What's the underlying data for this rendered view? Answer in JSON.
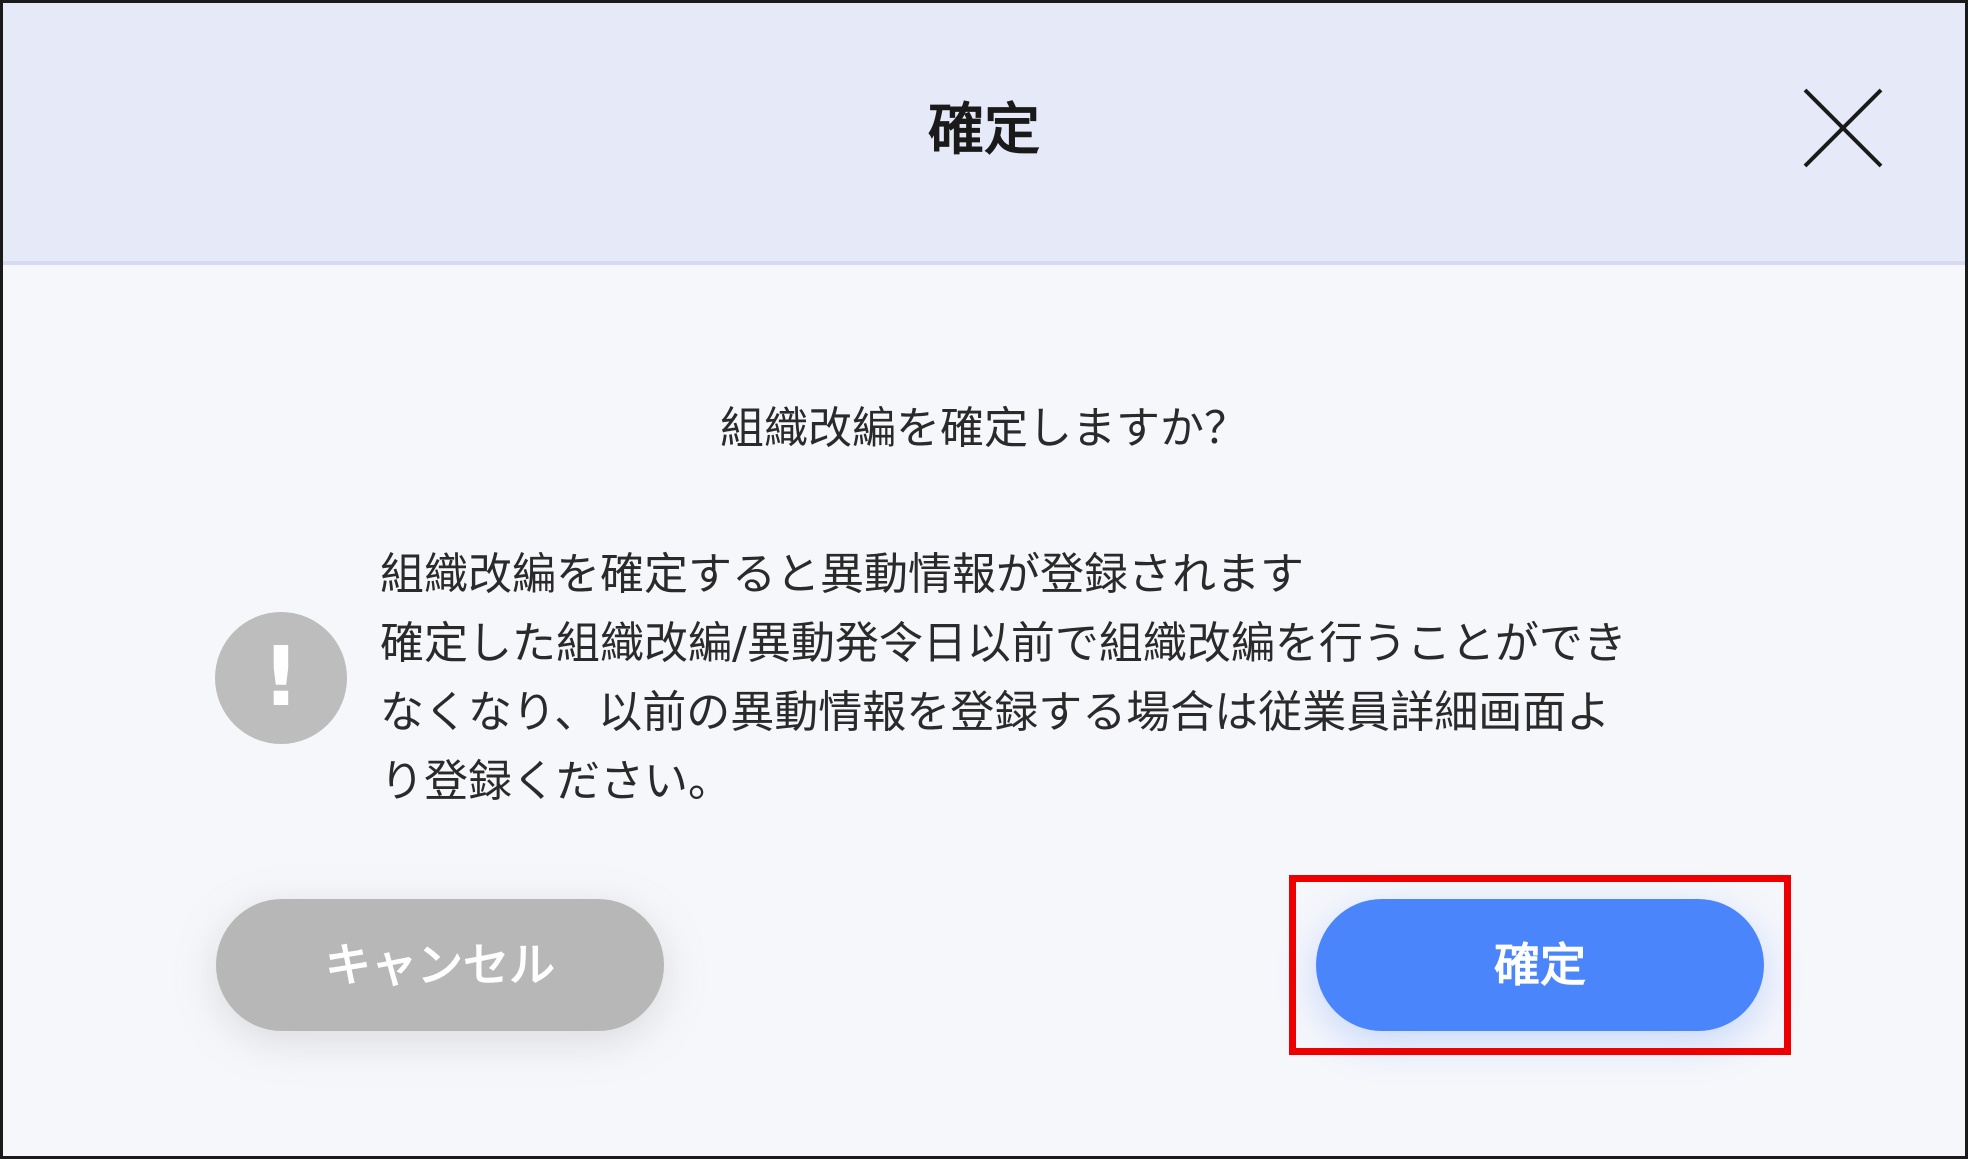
{
  "dialog": {
    "title": "確定",
    "close_icon": "close-icon",
    "question": "組織改編を確定しますか？",
    "alert_icon": "exclamation-icon",
    "alert_symbol": "!",
    "message_lines": [
      "組織改編を確定すると異動情報が登録されます",
      "確定した組織改編/異動発令日以前で組織改編を行うことができ",
      "なくなり、以前の異動情報を登録する場合は従業員詳細画面よ",
      "り登録ください。"
    ],
    "cancel_label": "キャンセル",
    "confirm_label": "確定"
  },
  "colors": {
    "header_bg": "#e6e9f7",
    "body_bg": "#f6f7fb",
    "confirm_button": "#4a85fb",
    "cancel_button": "#b7b7b7",
    "highlight": "#ee0000"
  }
}
